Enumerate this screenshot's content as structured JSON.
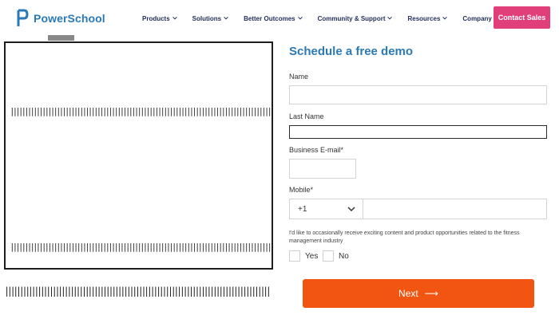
{
  "header": {
    "logo_text": "PowerSchool",
    "nav": [
      {
        "label": "Products"
      },
      {
        "label": "Solutions"
      },
      {
        "label": "Better Outcomes"
      },
      {
        "label": "Community & Support"
      },
      {
        "label": "Resources"
      },
      {
        "label": "Company"
      }
    ],
    "cta_label": "Contact Sales"
  },
  "form": {
    "title": "Schedule a free demo",
    "name_label": "Name",
    "last_name_label": "Last Name",
    "email_label": "Business E-mail*",
    "mobile_label": "Mobile*",
    "country_code": "+1",
    "consent_text": "I'd like to occasionally receive exciting content and product opportunities related to the fitness management industry",
    "yes_label": "Yes",
    "no_label": "No",
    "next_label": "Next",
    "next_arrow": "⟶"
  },
  "colors": {
    "brand_blue": "#2a7ab8",
    "contact_pink": "#e03f7a",
    "next_orange": "#f25412"
  }
}
